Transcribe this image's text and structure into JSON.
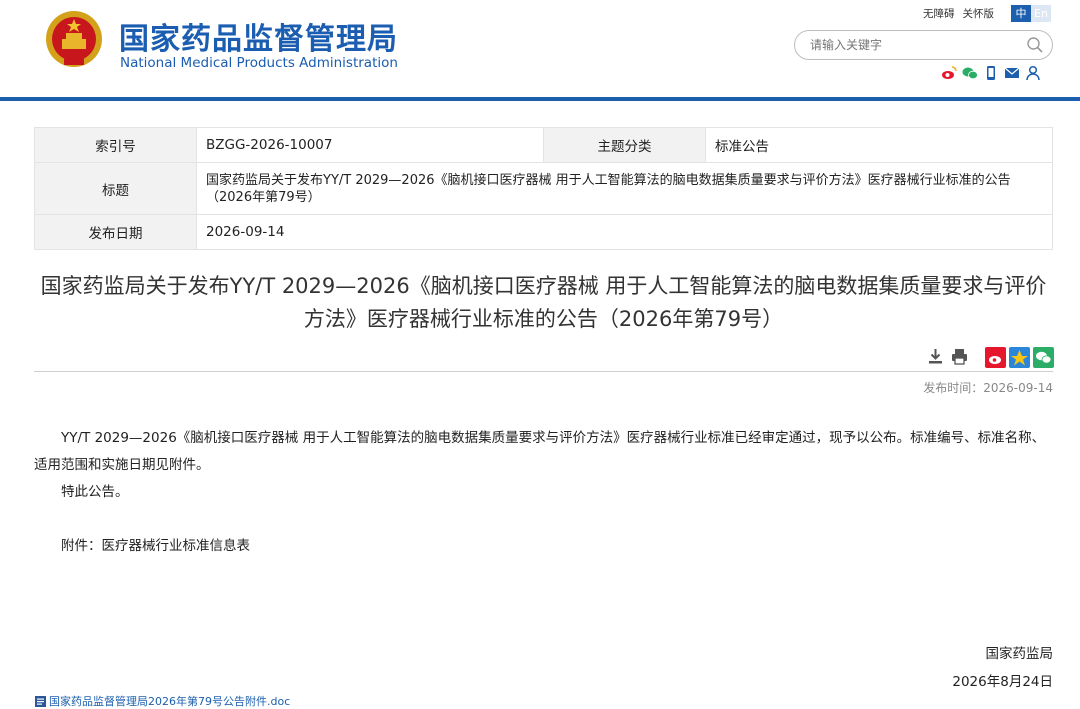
{
  "header": {
    "logo_cn": "国家药品监督管理局",
    "logo_en": "National Medical Products Administration",
    "top_links": [
      "无障碍",
      "关怀版"
    ],
    "lang": [
      "中",
      "En"
    ],
    "search_placeholder": "请输入关键字",
    "share_icons": [
      "weibo-icon",
      "wechat-icon",
      "mobile-icon",
      "mail-icon",
      "user-icon"
    ],
    "brand_color": "#1c5fae"
  },
  "meta": {
    "index_label": "索引号",
    "index_value": "BZGG-2026-10007",
    "category_label": "主题分类",
    "category_value": "标准公告",
    "title_label": "标题",
    "title_value": "国家药监局关于发布YY/T 2029—2026《脑机接口医疗器械 用于人工智能算法的脑电数据集质量要求与评价方法》医疗器械行业标准的公告（2026年第79号）",
    "date_label": "发布日期",
    "date_value": "2026-09-14"
  },
  "article": {
    "title": "国家药监局关于发布YY/T 2029—2026《脑机接口医疗器械 用于人工智能算法的脑电数据集质量要求与评价方法》医疗器械行业标准的公告（2026年第79号）",
    "tools": [
      "download-icon",
      "print-icon"
    ],
    "share": [
      "weibo-share-icon",
      "qzone-share-icon",
      "wechat-share-icon"
    ],
    "pub_time": "发布时间：2026-09-14",
    "paragraph1": "YY/T 2029—2026《脑机接口医疗器械 用于人工智能算法的脑电数据集质量要求与评价方法》医疗器械行业标准已经审定通过，现予以公布。标准编号、标准名称、适用范围和实施日期见附件。",
    "paragraph2": "特此公告。",
    "attachment_note": "附件：医疗器械行业标准信息表",
    "signature_org": "国家药监局",
    "signature_date": "2026年8月24日",
    "attachment_link": "国家药品监督管理局2026年第79号公告附件.doc"
  }
}
